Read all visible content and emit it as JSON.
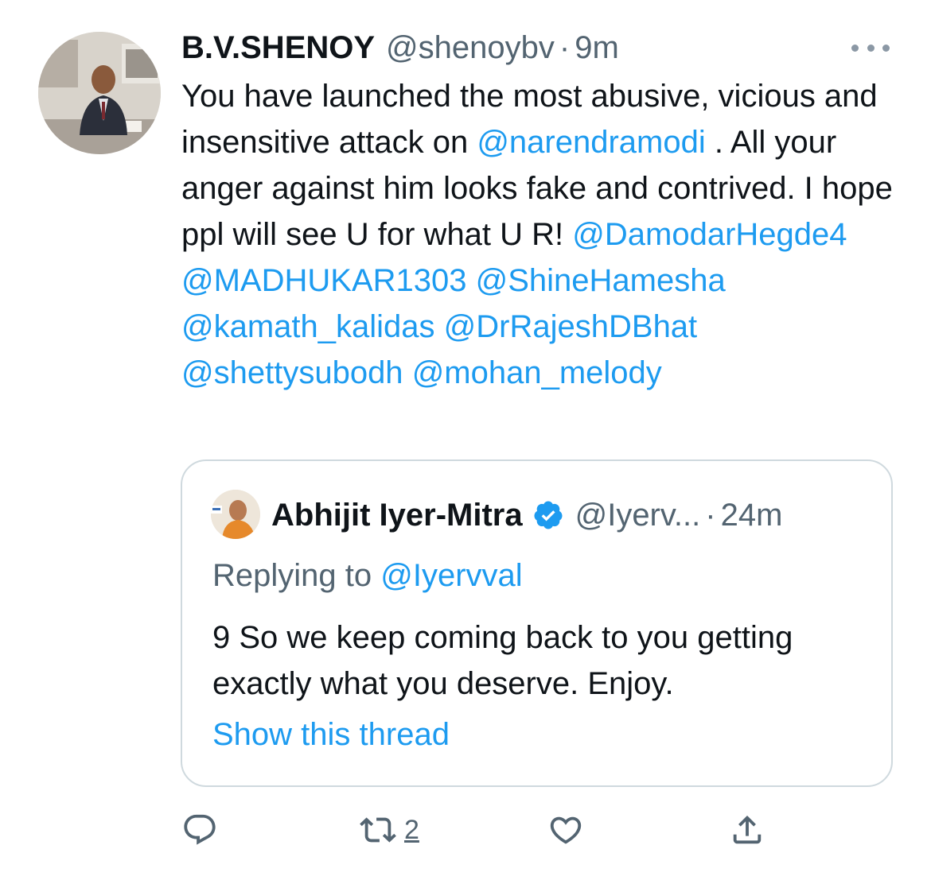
{
  "tweet": {
    "author_name": "B.V.SHENOY",
    "handle": "@shenoybv",
    "separator": "·",
    "time": "9m",
    "segments": [
      {
        "text": "You have launched the most abusive, vicious and  insensitive attack on ",
        "mention": false
      },
      {
        "text": "@narendramodi",
        "mention": true
      },
      {
        "text": " . All your anger against him looks fake and contrived. I hope ppl will see U for what U R! ",
        "mention": false
      },
      {
        "text": "@DamodarHegde4",
        "mention": true
      },
      {
        "text": " ",
        "mention": false
      },
      {
        "text": "@MADHUKAR1303",
        "mention": true
      },
      {
        "text": " ",
        "mention": false
      },
      {
        "text": "@ShineHamesha",
        "mention": true
      },
      {
        "text": " ",
        "mention": false
      },
      {
        "text": "@kamath_kalidas",
        "mention": true
      },
      {
        "text": " ",
        "mention": false
      },
      {
        "text": "@DrRajeshDBhat",
        "mention": true
      },
      {
        "text": " ",
        "mention": false
      },
      {
        "text": "@shettysubodh",
        "mention": true
      },
      {
        "text": " ",
        "mention": false
      },
      {
        "text": "@mohan_melody",
        "mention": true
      }
    ]
  },
  "quoted": {
    "author_name": "Abhijit Iyer-Mitra",
    "handle": "@Iyerv...",
    "separator": "·",
    "time": "24m",
    "replying_prefix": "Replying to ",
    "replying_handle": "@Iyervval",
    "text": "9 So we keep coming back to you getting exactly what you deserve. Enjoy.",
    "show_thread": "Show this thread"
  },
  "actions": {
    "retweet_count": "2",
    "icons": [
      "reply-icon",
      "retweet-icon",
      "like-icon",
      "share-icon"
    ]
  },
  "colors": {
    "mention": "#1d9bf0",
    "secondary_text": "#536471",
    "border": "#cfd9de",
    "verified": "#1d9bf0"
  }
}
